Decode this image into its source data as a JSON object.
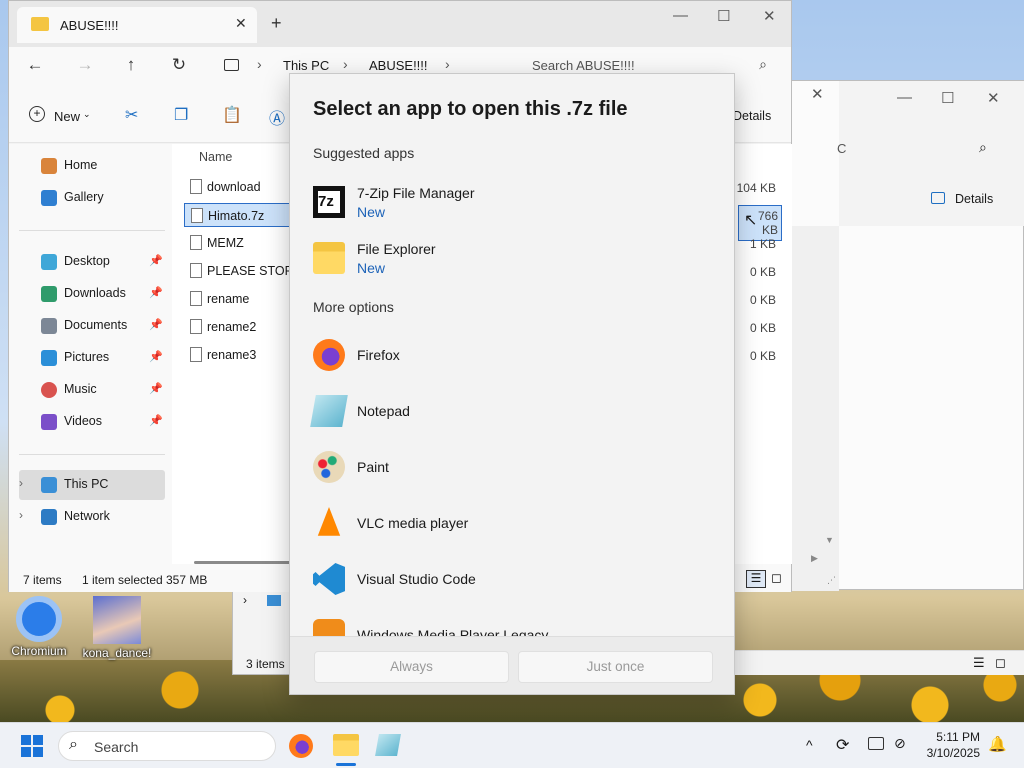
{
  "explorer": {
    "tab_title": "ABUSE!!!!",
    "breadcrumbs": [
      "This PC",
      "ABUSE!!!!"
    ],
    "search_placeholder": "Search ABUSE!!!!",
    "new_label": "New",
    "details_label": "Details",
    "column_name": "Name",
    "nav": {
      "home": "Home",
      "gallery": "Gallery",
      "desktop": "Desktop",
      "downloads": "Downloads",
      "documents": "Documents",
      "pictures": "Pictures",
      "music": "Music",
      "videos": "Videos",
      "this_pc": "This PC",
      "network": "Network"
    },
    "files": [
      {
        "name": "download",
        "size": "104 KB"
      },
      {
        "name": "Himato.7z",
        "size": "766 KB"
      },
      {
        "name": "MEMZ",
        "size": "1 KB"
      },
      {
        "name": "PLEASE STOP DI",
        "size": "0 KB"
      },
      {
        "name": "rename",
        "size": "0 KB"
      },
      {
        "name": "rename2",
        "size": "0 KB"
      },
      {
        "name": "rename3",
        "size": "0 KB"
      }
    ],
    "status": {
      "items": "7 items",
      "selected": "1 item selected",
      "sel_size": "357 MB"
    }
  },
  "back_window": {
    "search_fragment": "C",
    "details_label": "Details"
  },
  "bottom_window": {
    "items": "3 items"
  },
  "dialog": {
    "title": "Select an app to open this .7z file",
    "suggested_label": "Suggested apps",
    "more_label": "More options",
    "suggested": [
      {
        "name": "7-Zip File Manager",
        "tag": "New",
        "icon_text": "7z"
      },
      {
        "name": "File Explorer",
        "tag": "New"
      }
    ],
    "more": [
      {
        "name": "Firefox"
      },
      {
        "name": "Notepad"
      },
      {
        "name": "Paint"
      },
      {
        "name": "VLC media player"
      },
      {
        "name": "Visual Studio Code"
      },
      {
        "name": "Windows Media Player Legacy"
      }
    ],
    "always_label": "Always",
    "once_label": "Just once"
  },
  "desktop": {
    "icons": [
      {
        "label": "Chromium"
      },
      {
        "label": "kona_dance!"
      }
    ]
  },
  "taskbar": {
    "search_label": "Search",
    "time": "5:11 PM",
    "date": "3/10/2025"
  }
}
